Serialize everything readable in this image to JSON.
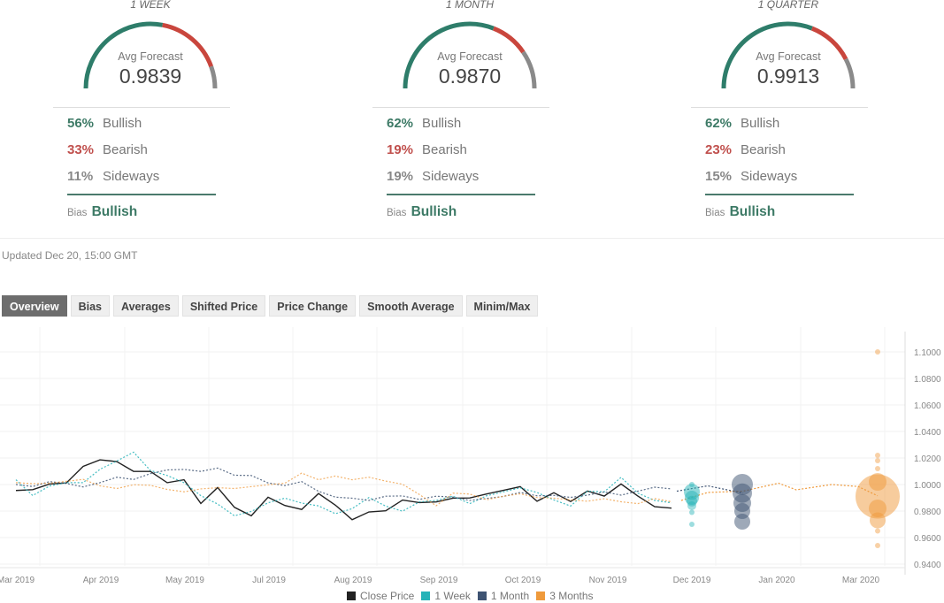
{
  "forecast_panels": [
    {
      "title": "1 WEEK",
      "avg_label": "Avg Forecast",
      "avg_value": "0.9839",
      "bullish_pct": "56%",
      "bullish_label": "Bullish",
      "bearish_pct": "33%",
      "bearish_label": "Bearish",
      "sideways_pct": "11%",
      "sideways_label": "Sideways",
      "bias_label": "Bias",
      "bias_value": "Bullish",
      "gauge": {
        "bullish": 0.56,
        "bearish": 0.33,
        "sideways": 0.11
      }
    },
    {
      "title": "1 MONTH",
      "avg_label": "Avg Forecast",
      "avg_value": "0.9870",
      "bullish_pct": "62%",
      "bullish_label": "Bullish",
      "bearish_pct": "19%",
      "bearish_label": "Bearish",
      "sideways_pct": "19%",
      "sideways_label": "Sideways",
      "bias_label": "Bias",
      "bias_value": "Bullish",
      "gauge": {
        "bullish": 0.62,
        "bearish": 0.19,
        "sideways": 0.19
      }
    },
    {
      "title": "1 QUARTER",
      "avg_label": "Avg Forecast",
      "avg_value": "0.9913",
      "bullish_pct": "62%",
      "bullish_label": "Bullish",
      "bearish_pct": "23%",
      "bearish_label": "Bearish",
      "sideways_pct": "15%",
      "sideways_label": "Sideways",
      "bias_label": "Bias",
      "bias_value": "Bullish",
      "gauge": {
        "bullish": 0.62,
        "bearish": 0.23,
        "sideways": 0.15
      }
    }
  ],
  "colors": {
    "bullish": "#2e7d6a",
    "bearish": "#c9463d",
    "sideways": "#8a8a8a",
    "close": "#222222",
    "week": "#26b3b8",
    "month": "#3e5372",
    "quarter": "#ef9a3c"
  },
  "updated": "Updated Dec 20, 15:00 GMT",
  "tabs": [
    "Overview",
    "Bias",
    "Averages",
    "Shifted Price",
    "Price Change",
    "Smooth Average",
    "Minim/Max"
  ],
  "active_tab": "Overview",
  "chart_data": {
    "type": "line",
    "title": "",
    "xlabel": "",
    "ylabel": "",
    "x_ticks": [
      "Mar 2019",
      "Apr 2019",
      "May 2019",
      "Jul 2019",
      "Aug 2019",
      "Sep 2019",
      "Oct 2019",
      "Nov 2019",
      "Dec 2019",
      "Jan 2020",
      "Mar 2020"
    ],
    "y_ticks": [
      "1.1000",
      "1.0800",
      "1.0600",
      "1.0400",
      "1.0200",
      "1.0000",
      "0.9800",
      "0.9600",
      "0.9400"
    ],
    "ylim": [
      0.94,
      1.11
    ],
    "grid": true,
    "legend_position": "bottom",
    "series": [
      {
        "name": "Close Price",
        "style": "solid",
        "values": [
          0.9955,
          0.9961,
          1.0004,
          1.0012,
          1.0137,
          1.0186,
          1.0173,
          1.0099,
          1.0099,
          1.0014,
          1.0036,
          0.9857,
          0.9977,
          0.9828,
          0.9764,
          0.9904,
          0.9842,
          0.9812,
          0.9932,
          0.9845,
          0.9735,
          0.9793,
          0.9802,
          0.9883,
          0.9864,
          0.9869,
          0.9897,
          0.9899,
          0.9929,
          0.9956,
          0.9984,
          0.9874,
          0.9938,
          0.9872,
          0.9951,
          0.9913,
          1.0004,
          0.9913,
          0.9833,
          0.9822
        ]
      },
      {
        "name": "1 Week",
        "style": "dotted",
        "values": [
          1.0036,
          0.9917,
          0.9989,
          1.0014,
          1.0014,
          1.0115,
          1.0177,
          1.0244,
          1.0106,
          1.0068,
          1.0014,
          0.9916,
          0.9853,
          0.9764,
          0.9797,
          0.9862,
          0.9897,
          0.986,
          0.9839,
          0.978,
          0.9818,
          0.9902,
          0.9837,
          0.9799,
          0.9869,
          0.988,
          0.9912,
          0.9856,
          0.9915,
          0.9945,
          0.9975,
          0.994,
          0.9884,
          0.9838,
          0.995,
          0.9945,
          1.0054,
          0.9935,
          0.988,
          0.9862
        ]
      },
      {
        "name": "1 Month",
        "style": "dotted",
        "values": [
          1.0,
          0.9985,
          1.0022,
          1.0008,
          0.9982,
          1.0014,
          1.0055,
          1.0038,
          1.0082,
          1.011,
          1.0114,
          1.0099,
          1.0124,
          1.007,
          1.0068,
          1.0012,
          0.9992,
          1.0022,
          0.9949,
          0.9905,
          0.9897,
          0.988,
          0.9912,
          0.9914,
          0.9888,
          0.9912,
          0.9905,
          0.988,
          0.9895,
          0.991,
          0.994,
          0.9915,
          0.9918,
          0.9903,
          0.992,
          0.9944,
          0.992,
          0.995,
          0.998,
          0.9967
        ]
      },
      {
        "name": "3 Months",
        "style": "dotted",
        "values": [
          1.0014,
          1.0006,
          1.001,
          1.0024,
          1.0039,
          0.999,
          0.997,
          0.9998,
          0.9994,
          0.9963,
          0.9945,
          0.9967,
          0.9976,
          0.997,
          0.9984,
          0.9998,
          1.001,
          1.0086,
          1.0036,
          1.0064,
          1.0036,
          1.0055,
          1.0026,
          1.0002,
          0.9925,
          0.984,
          0.9935,
          0.9928,
          0.9885,
          0.9912,
          0.993,
          0.9902,
          0.9897,
          0.9885,
          0.9874,
          0.9893,
          0.987,
          0.9856,
          0.9894,
          0.987
        ]
      }
    ],
    "forecast_bubbles": {
      "1 Week": [
        1.0,
        0.9945,
        0.99,
        0.9875,
        0.984,
        0.979,
        0.97
      ],
      "1 Month": [
        1.0,
        0.9935,
        0.986,
        0.98,
        0.972
      ],
      "3 Months": [
        1.1,
        1.022,
        1.018,
        1.012,
        1.002,
        0.991,
        0.982,
        0.973,
        0.965,
        0.954
      ]
    }
  }
}
